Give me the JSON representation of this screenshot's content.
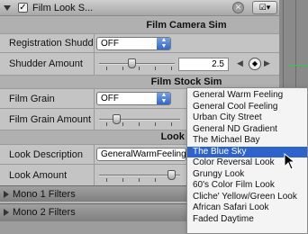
{
  "header": {
    "title": "Film Look S...",
    "close_symbol": "✕",
    "preset_symbol": "☑▾"
  },
  "sections": {
    "film_camera_sim": "Film Camera Sim",
    "film_stock_sim": "Film Stock Sim",
    "look_book": "Look Book"
  },
  "params": {
    "registration_shudder": {
      "label": "Registration Shudder",
      "value": "OFF"
    },
    "shudder_amount": {
      "label": "Shudder Amount",
      "value": "2.5",
      "slider_fraction": 0.4
    },
    "film_grain": {
      "label": "Film Grain",
      "value": "OFF"
    },
    "film_grain_amount": {
      "label": "Film Grain Amount",
      "slider_fraction": 0.3
    },
    "look_description": {
      "label": "Look Description",
      "value": "GeneralWarmFeeling"
    },
    "look_amount": {
      "label": "Look Amount",
      "slider_fraction": 0.9
    }
  },
  "groups": {
    "mono1": "Mono 1 Filters",
    "mono2": "Mono 2 Filters"
  },
  "menu": {
    "items": [
      "General Warm Feeling",
      "General Cool Feeling",
      "Urban City Street",
      "General ND Gradient",
      "The Michael Bay",
      "The Blue Sky",
      "Color Reversal Look",
      "Grungy Look",
      "60's Color Film Look",
      "Cliche' Yellow/Green Look",
      "African Safari Look",
      "Faded Daytime"
    ],
    "selected_index": 5
  },
  "colors": {
    "selection": "#2f63cc",
    "keyframe_line": "#34c84a"
  }
}
